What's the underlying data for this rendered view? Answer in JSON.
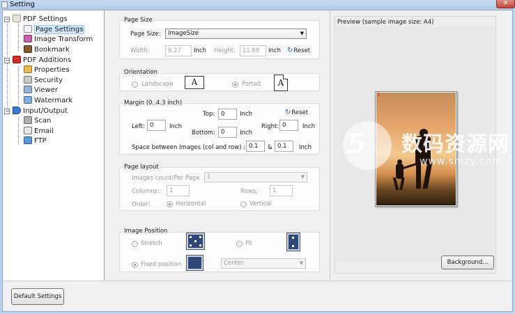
{
  "window": {
    "title": "Setting",
    "close": "✕"
  },
  "tree": {
    "items": [
      {
        "label": "PDF Settings",
        "icon": "pdf-settings-icon"
      },
      {
        "label": "Page Settings",
        "icon": "page-settings-icon"
      },
      {
        "label": "Image Transform",
        "icon": "image-transform-icon"
      },
      {
        "label": "Bookmark",
        "icon": "bookmark-icon"
      },
      {
        "label": "PDF Additions",
        "icon": "pdf-additions-icon"
      },
      {
        "label": "Properties",
        "icon": "properties-icon"
      },
      {
        "label": "Security",
        "icon": "security-icon"
      },
      {
        "label": "Viewer",
        "icon": "viewer-icon"
      },
      {
        "label": "Watermark",
        "icon": "watermark-icon"
      },
      {
        "label": "Input/Output",
        "icon": "input-output-icon"
      },
      {
        "label": "Scan",
        "icon": "scan-icon"
      },
      {
        "label": "Email",
        "icon": "email-icon"
      },
      {
        "label": "FTP",
        "icon": "ftp-icon"
      }
    ],
    "expander": "−",
    "selected": "Page Settings"
  },
  "page_size": {
    "title": "Page Size",
    "size_label": "Page Size:",
    "size_value": "ImageSize",
    "width_label": "Width:",
    "width_value": "8.27",
    "width_unit": "Inch",
    "height_label": "Height:",
    "height_value": "11.69",
    "height_unit": "Inch",
    "reset": "Reset"
  },
  "orientation": {
    "title": "Orientation",
    "landscape": "Landscape",
    "portrait": "Portait",
    "icon_letter": "A",
    "selected": "Portait"
  },
  "margin": {
    "title": "Margin (0..4.3 inch)",
    "reset": "Reset",
    "top_label": "Top:",
    "top_value": "0",
    "left_label": "Left:",
    "left_value": "0",
    "right_label": "Right:",
    "right_value": "0",
    "bottom_label": "Bottom:",
    "bottom_value": "0",
    "unit": "Inch",
    "space_label": "Space between Images (col and row) :",
    "space_col": "0.1",
    "space_and": "&",
    "space_row": "0.1",
    "space_unit": "Inch"
  },
  "page_layout": {
    "title": "Page layout",
    "count_label": "Images count/Per Page",
    "count_value": "1",
    "columns_label": "Columns:",
    "columns_value": "1",
    "rows_label": "Rows:",
    "rows_value": "1",
    "order_label": "Order:",
    "horizontal": "Horizontal",
    "vertical": "Vertical",
    "selected": "Horizontal"
  },
  "image_position": {
    "title": "Image Position",
    "stretch": "Stretch",
    "fit": "Fit",
    "fixed": "Fixed position",
    "position_value": "Center",
    "selected": "Fixed position"
  },
  "preview": {
    "title": "Preview (sample image size: A4)",
    "page_number": "1",
    "background_button": "Background..."
  },
  "footer": {
    "default_button": "Default Settings"
  },
  "watermark": {
    "logo": "5",
    "text": "数码资源网",
    "url": "www.smzy.com"
  },
  "colors": {
    "title_bar": "#b9d1ea",
    "selection": "#cde8ff",
    "reset_icon": "#2860c0",
    "position_icon": "#2e4776"
  }
}
